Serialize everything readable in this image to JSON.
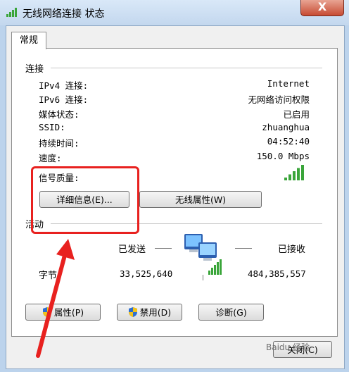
{
  "window": {
    "title": "无线网络连接 状态",
    "close_label": "X"
  },
  "tabs": [
    {
      "label": "常规"
    }
  ],
  "connection": {
    "section_label": "连接",
    "rows": [
      {
        "label": "IPv4 连接:",
        "value": "Internet"
      },
      {
        "label": "IPv6 连接:",
        "value": "无网络访问权限"
      },
      {
        "label": "媒体状态:",
        "value": "已启用"
      },
      {
        "label": "SSID:",
        "value": "zhuanghua"
      },
      {
        "label": "持续时间:",
        "value": "04:52:40"
      },
      {
        "label": "速度:",
        "value": "150.0 Mbps"
      }
    ],
    "signal_label": "信号质量:",
    "signal_bars_lit": 5,
    "signal_bars_total": 5
  },
  "buttons": {
    "details": "详细信息(E)...",
    "wireless_props": "无线属性(W)",
    "properties": "属性(P)",
    "disable": "禁用(D)",
    "diagnose": "诊断(G)",
    "close": "关闭(C)"
  },
  "activity": {
    "section_label": "活动",
    "sent_label": "已发送",
    "received_label": "已接收",
    "bytes_label": "字节:",
    "bytes_sent": "33,525,640",
    "bytes_received": "484,385,557"
  },
  "watermark": "Baidu 经验",
  "colors": {
    "annotation": "#e8211f",
    "signal": "#3aa53a",
    "shield_blue": "#2f6fcf",
    "shield_yellow": "#f3c21a"
  }
}
